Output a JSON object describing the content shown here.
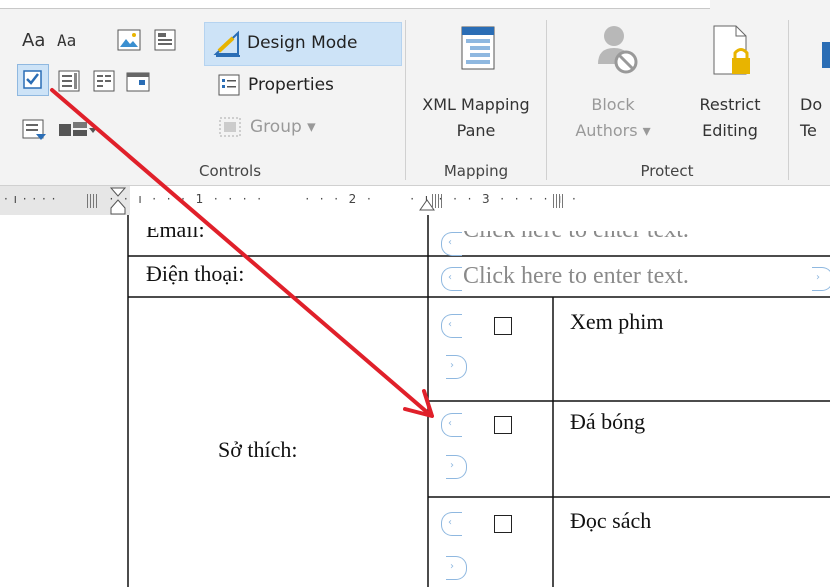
{
  "ribbon": {
    "controls": {
      "design_mode": "Design Mode",
      "properties": "Properties",
      "group": "Group ▾",
      "label": "Controls",
      "aa1": "Aa",
      "aa2": "Aa"
    },
    "mapping": {
      "xml_line1": "XML Mapping",
      "xml_line2": "Pane",
      "label": "Mapping"
    },
    "protect": {
      "block_line1": "Block",
      "block_line2": "Authors ▾",
      "restrict_line1": "Restrict",
      "restrict_line2": "Editing",
      "label": "Protect"
    },
    "cut_doc": {
      "line1": "Do",
      "line2": "Te"
    }
  },
  "ruler": {
    "text": "· ı · · · ·           ·  ·  ı  ·  ·  ·  1  ·  ·  ·  ·         ·  ·  ·  2  ·        ·  ı  ·  ·  ·  3  ·  ·  ·  ·  ı  ·"
  },
  "document": {
    "row1_label": "Email:",
    "row2_label": "Điện thoại:",
    "placeholder": "Click here to enter text.",
    "hobby_label": "Sở thích:",
    "hobbies": [
      "Xem phim",
      "Đá bóng",
      "Đọc sách"
    ]
  },
  "colors": {
    "arrow": "#e0202a",
    "tag": "#8fb8e0",
    "selected_bg": "#cde3f7"
  }
}
